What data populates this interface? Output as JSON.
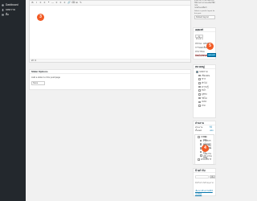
{
  "sidebar": {
    "items": [
      {
        "label": "Dashboard",
        "active": false
      },
      {
        "label": "บทความ",
        "active": true
      },
      {
        "label": "สื่อ",
        "active": false
      }
    ]
  },
  "editor": {
    "toolbar_icons": [
      "B",
      "I",
      "≡",
      "≡",
      "❝",
      "—",
      "≡",
      "≡",
      "≡",
      "🔗",
      "⌫",
      "⊞",
      "✎"
    ],
    "status": "คำ: 0",
    "badge": "3"
  },
  "help_text": {
    "lines": [
      "ตัวอย่างการใช้งานต่อไปนี้",
      "ให้ท่านอ่านรายละเอียดให้ดีก่อน",
      "ก่อนที่จะลงมือทำ"
    ],
    "select_label": "Select a specific layout for this post:",
    "select_value": "Default layout"
  },
  "publish": {
    "title": "เผยแพร่",
    "preview_btn": "ดูตัวอย่าง",
    "status": "สถานะ: ฉบับร่าง",
    "visibility": "การมองเห็น: สาธารณะ",
    "schedule": "เผยแพร่ทันที",
    "trash": "ย้ายไปถังขยะ",
    "publish_btn": "เผยแพร่",
    "badge": "5"
  },
  "slider_options": {
    "title": "Slider Options",
    "label": "Add a slider to this post/page",
    "select_value": "None"
  },
  "categories": {
    "title": "หมวดหมู่",
    "items": [
      {
        "label": "บทความ",
        "checked": true,
        "sub": false
      },
      {
        "label": "เรื่องเด่น",
        "checked": false,
        "sub": true
      },
      {
        "label": "ข่าว",
        "checked": false,
        "sub": true
      },
      {
        "label": "ทั่วไป",
        "checked": false,
        "sub": true
      },
      {
        "label": "ความรู้",
        "checked": false,
        "sub": true
      },
      {
        "label": "กีฬา",
        "checked": false,
        "sub": true
      },
      {
        "label": "ธุรกิจ",
        "checked": false,
        "sub": true
      },
      {
        "label": "วิดีโอ",
        "checked": false,
        "sub": true
      },
      {
        "label": "เพลง",
        "checked": false,
        "sub": true
      },
      {
        "label": "เกม",
        "checked": false,
        "sub": true
      }
    ]
  },
  "section": {
    "title": "ส่วนงาน",
    "tabs": [
      "ส่วนงานทั้งหมด",
      "ใช้บ่อย"
    ],
    "items": [
      {
        "label": "หน่วย",
        "checked": false,
        "sub": false
      },
      {
        "label": "กลุ่มงานการบริหาร",
        "checked": false,
        "sub": true
      },
      {
        "label": "กลุ่มนโยบายและแผน",
        "checked": false,
        "sub": true
      },
      {
        "label": "กลุ่มงานบุคคล",
        "checked": false,
        "sub": true
      },
      {
        "label": "กลุ่มงานงบประมาณ",
        "checked": false,
        "sub": true
      },
      {
        "label": "กลุ่มงานพัสดุ",
        "checked": false,
        "sub": true
      },
      {
        "label": "ฝ่ายบริหาร",
        "checked": false,
        "sub": false
      }
    ],
    "badge": "4"
  },
  "tags": {
    "title": "ป้ายกำกับ",
    "add_btn": "เพิ่ม",
    "hint": "คั่นป้ายกำกับด้วยจุลภาค",
    "link": "เลือกจากป้ายกำกับที่ใช้บ่อยที่สุด"
  }
}
